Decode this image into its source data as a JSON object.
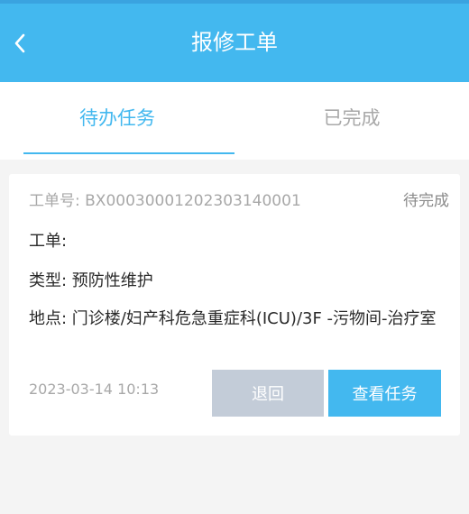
{
  "header": {
    "title": "报修工单",
    "back_icon": "chevron-left-icon",
    "color": "#43b8ef"
  },
  "tabs": [
    {
      "label": "待办任务",
      "active": true
    },
    {
      "label": "已完成",
      "active": false
    }
  ],
  "order": {
    "number_label": "工单号: BX0003000120230314000​1",
    "status": "待完成",
    "name_line": "工单:",
    "type_line": "类型: 预防性维护",
    "location_line": "地点: 门诊楼/妇产科危急重症科(ICU)/3F -污物间-治疗室",
    "datetime": "2023-03-14 10:13",
    "return_label": "退回",
    "view_label": "查看任务"
  },
  "colors": {
    "accent": "#43b8ef",
    "secondary_button": "#c3ccd8",
    "muted_text": "#a8a8a8"
  }
}
